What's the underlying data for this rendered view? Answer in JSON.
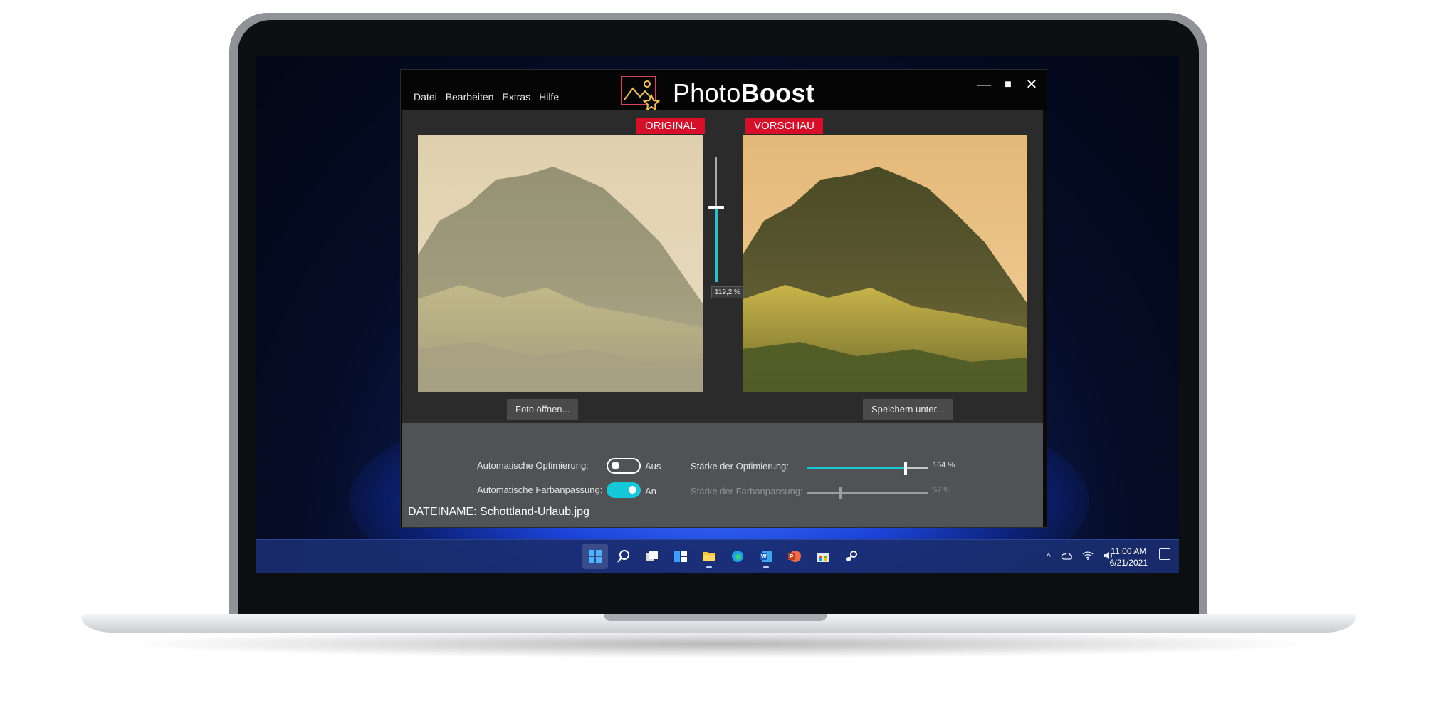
{
  "app": {
    "menu": [
      "Datei",
      "Bearbeiten",
      "Extras",
      "Hilfe"
    ],
    "brand_light": "Photo",
    "brand_bold": "Boost",
    "window_controls": {
      "minimize": "—",
      "maximize": "■",
      "close": "✕"
    }
  },
  "panels": {
    "original_tag": "ORIGINAL",
    "preview_tag": "VORSCHAU",
    "open_button": "Foto öffnen...",
    "save_button": "Speichern unter..."
  },
  "blend_slider": {
    "value_percent": 119.2,
    "label": "119,2 %"
  },
  "controls": {
    "auto_opt_label": "Automatische Optimierung:",
    "auto_opt_state": "Aus",
    "auto_opt_on": false,
    "auto_color_label": "Automatische Farbanpassung:",
    "auto_color_state": "An",
    "auto_color_on": true,
    "opt_strength_label": "Stärke der Optimierung:",
    "opt_strength_value": 164,
    "opt_strength_text": "164 %",
    "color_strength_label": "Stärke der Farbanpassung:",
    "color_strength_value": 57,
    "color_strength_text": "57 %"
  },
  "filename": "DATEINAME: Schottland-Urlaub.jpg",
  "taskbar": {
    "time": "11:00 AM",
    "date": "6/21/2021",
    "icons": [
      "start-icon",
      "search-icon",
      "task-view-icon",
      "widgets-icon",
      "file-explorer-icon",
      "edge-icon",
      "word-icon",
      "powerpoint-icon",
      "store-icon",
      "steam-icon"
    ]
  },
  "colors": {
    "accent": "#14c8d8",
    "tag_red": "#d70f29",
    "window_bg": "#2b2b2b",
    "controls_bg": "#505256"
  }
}
